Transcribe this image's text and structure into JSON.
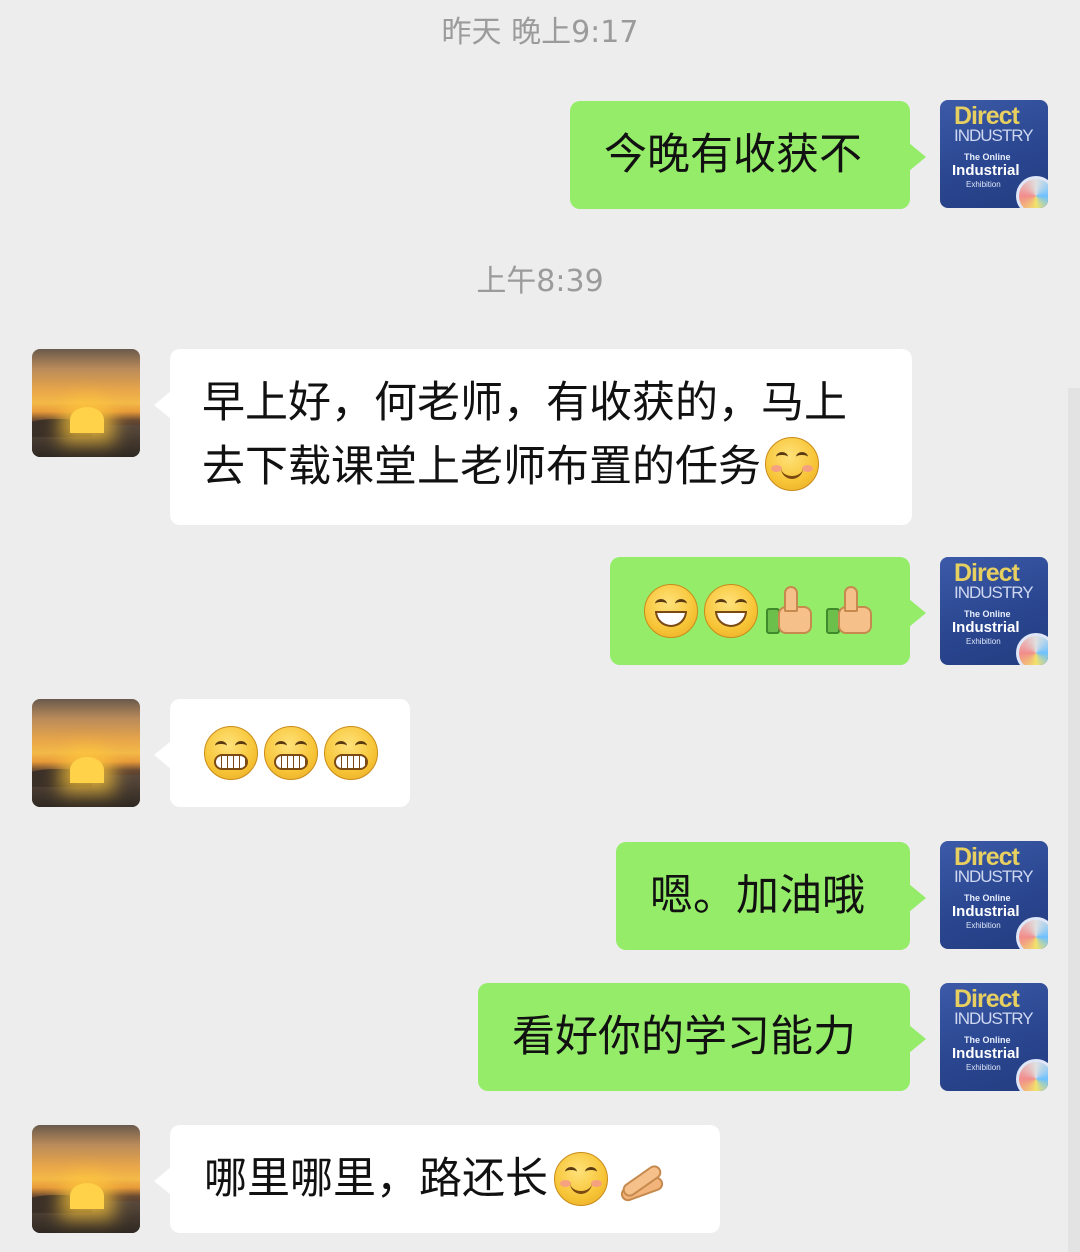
{
  "timestamps": {
    "yesterday": "昨天 晚上9:17",
    "morning": "上午8:39"
  },
  "avatars": {
    "me": {
      "line1": "Direct",
      "line2": "INDUSTRY",
      "line3": "The Online",
      "line4": "Industrial",
      "line5": "Exhibition"
    }
  },
  "messages": [
    {
      "sender": "me",
      "text": "今晚有收获不"
    },
    {
      "sender": "friend",
      "text": "早上好，何老师，有收获的，马上去下载课堂上老师布置的任务",
      "emoji": [
        "smiling-face-with-blush-icon"
      ]
    },
    {
      "sender": "me",
      "text": "",
      "emoji": [
        "grinning-face-icon",
        "grinning-face-icon",
        "thumbs-up-icon",
        "thumbs-up-icon"
      ]
    },
    {
      "sender": "friend",
      "text": "",
      "emoji": [
        "grimacing-face-icon",
        "grimacing-face-icon",
        "grimacing-face-icon"
      ]
    },
    {
      "sender": "me",
      "text": "嗯。加油哦"
    },
    {
      "sender": "me",
      "text": "看好你的学习能力"
    },
    {
      "sender": "friend",
      "text": "哪里哪里，路还长",
      "emoji": [
        "smiling-face-with-blush-icon",
        "clasping-hands-icon"
      ]
    }
  ]
}
